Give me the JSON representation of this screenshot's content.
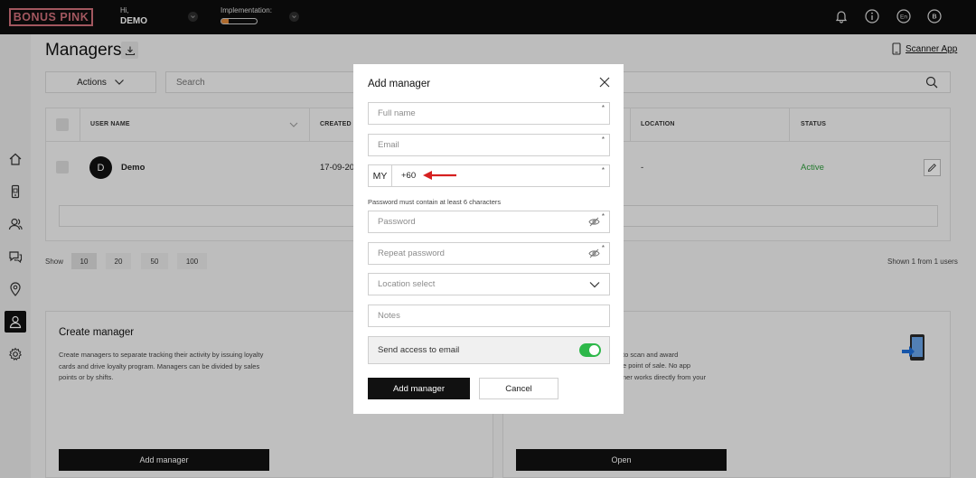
{
  "topbar": {
    "logo": "BONUS PINK",
    "greeting": "Hi,",
    "user_name": "DEMO",
    "implementation_label": "Implementation:",
    "implementation_progress": 0.2,
    "icons": [
      "bell-icon",
      "info-icon",
      "language-icon",
      "profile-icon"
    ],
    "language": "En",
    "profile_initial": "B"
  },
  "sidebar": {
    "items": [
      "home-icon",
      "mobile-icon",
      "clients-icon",
      "chat-icon",
      "location-icon",
      "managers-icon",
      "settings-icon"
    ],
    "active": "managers-icon"
  },
  "page": {
    "title": "Managers",
    "scanner_app": "Scanner App",
    "actions_label": "Actions",
    "search_placeholder": "Search"
  },
  "table": {
    "columns": [
      "USER NAME",
      "CREATED",
      "LOCATION",
      "STATUS"
    ],
    "rows": [
      {
        "avatar": "D",
        "name": "Demo",
        "created": "17-09-202",
        "location": "-",
        "status": "Active"
      }
    ]
  },
  "pagination": {
    "show_label": "Show",
    "sizes": [
      "10",
      "20",
      "50",
      "100"
    ],
    "active_size": "10",
    "shown_text": "Shown 1 from 1 users"
  },
  "cards": {
    "create_manager": {
      "title": "Create manager",
      "description": "Create managers to separate tracking their activity by issuing loyalty cards and drive loyalty program. Managers can be divided by sales points or by shifts.",
      "button": "Add manager"
    },
    "scanner": {
      "description_lines": [
        "to scan and award",
        "e point of sale. No app",
        "ner works directly from your"
      ],
      "button": "Open"
    }
  },
  "modal": {
    "title": "Add manager",
    "full_name_placeholder": "Full name",
    "email_placeholder": "Email",
    "phone_country": "MY",
    "phone_value": "+60",
    "password_hint": "Password must contain at least 6 characters",
    "password_placeholder": "Password",
    "repeat_password_placeholder": "Repeat password",
    "location_placeholder": "Location select",
    "notes_placeholder": "Notes",
    "send_access_label": "Send access to email",
    "send_access_enabled": true,
    "submit_label": "Add manager",
    "cancel_label": "Cancel",
    "required_mark": "*"
  },
  "colors": {
    "logo": "#d0707a",
    "toggle_on": "#2eb84a",
    "status_active": "#2e9d3c",
    "arrow": "#d62020",
    "progress": "#e08a3c"
  }
}
